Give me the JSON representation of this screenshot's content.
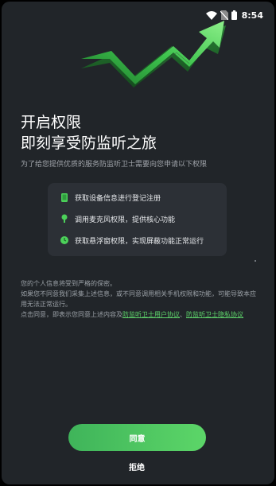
{
  "status_bar": {
    "time": "8:54",
    "icons": [
      "wifi-icon",
      "no-sim-icon",
      "battery-icon"
    ]
  },
  "hero": {
    "icon": "growth-arrow-icon",
    "accent_color": "#4cd15a"
  },
  "title": {
    "line1": "开启权限",
    "line2": "即刻享受防监听之旅"
  },
  "subtitle": "为了给您提供优质的服务防监听卫士需要向您申请以下权限",
  "permissions": [
    {
      "icon": "phone-icon",
      "label": "获取设备信息进行登记注册"
    },
    {
      "icon": "microphone-icon",
      "label": "调用麦克风权限，提供核心功能"
    },
    {
      "icon": "overlay-icon",
      "label": "获取悬浮窗权限，实现屏蔽功能正常运行"
    }
  ],
  "notice": {
    "line1": "您的个人信息将受到严格的保密。",
    "line2": "如果您不同意我们采集上述信息，或不同意调用相关手机权限和功能，可能导致本应用无法正常运行。",
    "line3_prefix": "点击同意，即表示您同意上述内容及",
    "user_agreement": "防监听卫士用户协议",
    "separator": "、",
    "privacy_policy": "防监听卫士隐私协议"
  },
  "buttons": {
    "agree": "同意",
    "reject": "拒绝"
  }
}
